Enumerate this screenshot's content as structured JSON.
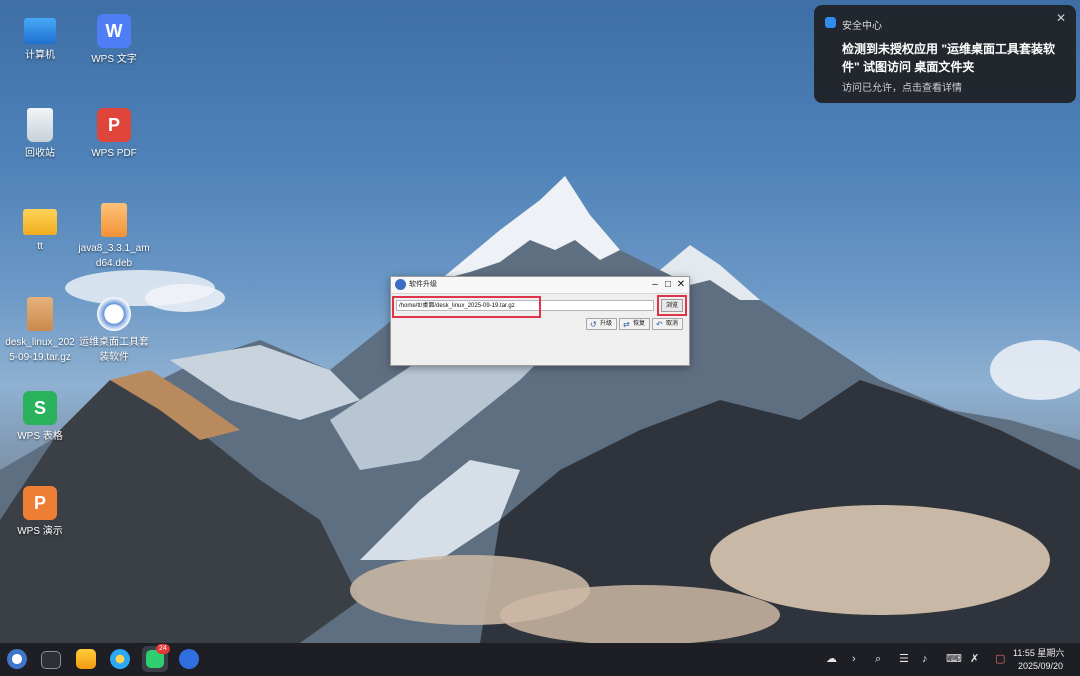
{
  "desktop": {
    "icons": [
      {
        "label": "计算机",
        "icon": "computer-icon"
      },
      {
        "label": "WPS 文字",
        "icon": "wps-writer-icon"
      },
      {
        "label": "回收站",
        "icon": "recycle-bin-icon"
      },
      {
        "label": "WPS PDF",
        "icon": "wps-pdf-icon"
      },
      {
        "label": "tt",
        "icon": "folder-icon"
      },
      {
        "label": "java8_3.3.1_amd64.deb",
        "icon": "deb-package-icon"
      },
      {
        "label": "desk_linux_2025-09-19.tar.gz",
        "icon": "archive-icon"
      },
      {
        "label": "运维桌面工具套装软件",
        "icon": "ops-tool-icon"
      },
      {
        "label": "WPS 表格",
        "icon": "wps-spreadsheet-icon"
      },
      {
        "label": "WPS 演示",
        "icon": "wps-presentation-icon"
      }
    ]
  },
  "dialog": {
    "title": "软件升级",
    "path_value": "/home/tt/桌面/desk_linux_2025-09-19.tar.gz",
    "browse_label": "浏览",
    "buttons": {
      "upgrade": "升级",
      "restore": "恢复",
      "cancel": "取消"
    }
  },
  "notification": {
    "app": "安全中心",
    "message": "检测到未授权应用 \"运维桌面工具套装软件\" 试图访问 桌面文件夹",
    "sub": "访问已允许，点击查看详情"
  },
  "taskbar": {
    "badge_count": "24",
    "clock_time": "11:55 星期六",
    "clock_date": "2025/09/20"
  },
  "colors": {
    "accent": "#2f8cf0",
    "highlight": "#e0344b",
    "taskbar": "#1d1f24"
  }
}
